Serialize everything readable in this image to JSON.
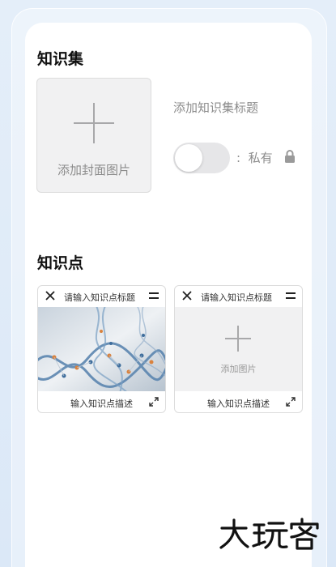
{
  "collection": {
    "section_title": "知识集",
    "cover_label": "添加封面图片",
    "title_placeholder": "添加知识集标题",
    "visibility_separator": ":",
    "visibility_label": "私有",
    "private_toggle": "off"
  },
  "points": {
    "section_title": "知识点",
    "cards": [
      {
        "title_placeholder": "请输入知识点标题",
        "has_image": true,
        "image_subject": "DNA double helix strands",
        "desc_placeholder": "输入知识点描述"
      },
      {
        "title_placeholder": "请输入知识点标题",
        "has_image": false,
        "add_image_label": "添加图片",
        "desc_placeholder": "输入知识点描述"
      }
    ]
  },
  "watermark": {
    "text": "大玩客"
  },
  "colors": {
    "background": "#dbe8f7",
    "card": "#ffffff",
    "placeholder_gray": "#8c8c8c",
    "toggle_off": "#e6e6e8"
  }
}
